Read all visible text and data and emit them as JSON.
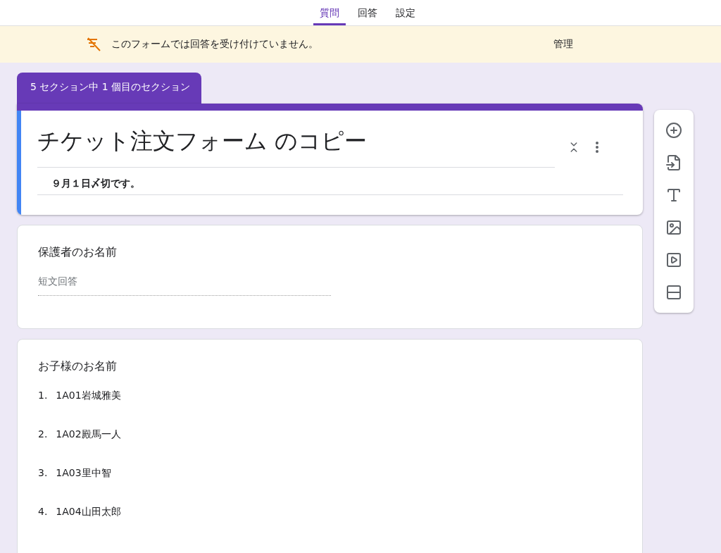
{
  "tabs": [
    {
      "label": "質問",
      "selected": true
    },
    {
      "label": "回答",
      "selected": false
    },
    {
      "label": "設定",
      "selected": false
    }
  ],
  "banner": {
    "message": "このフォームでは回答を受け付けていません。",
    "action": "管理"
  },
  "section_tab": "5 セクション中 1 個目のセクション",
  "form_header": {
    "title": "チケット注文フォーム のコピー",
    "description": "９月１日〆切です。"
  },
  "questions": [
    {
      "kind": "short",
      "title": "保護者のお名前",
      "placeholder": "短文回答"
    },
    {
      "kind": "list",
      "title": "お子様のお名前",
      "items": [
        {
          "number": "1.",
          "text": "1A01岩城雅美"
        },
        {
          "number": "2.",
          "text": "1A02殿馬一人"
        },
        {
          "number": "3.",
          "text": "1A03里中智"
        },
        {
          "number": "4.",
          "text": "1A04山田太郎"
        }
      ]
    }
  ]
}
